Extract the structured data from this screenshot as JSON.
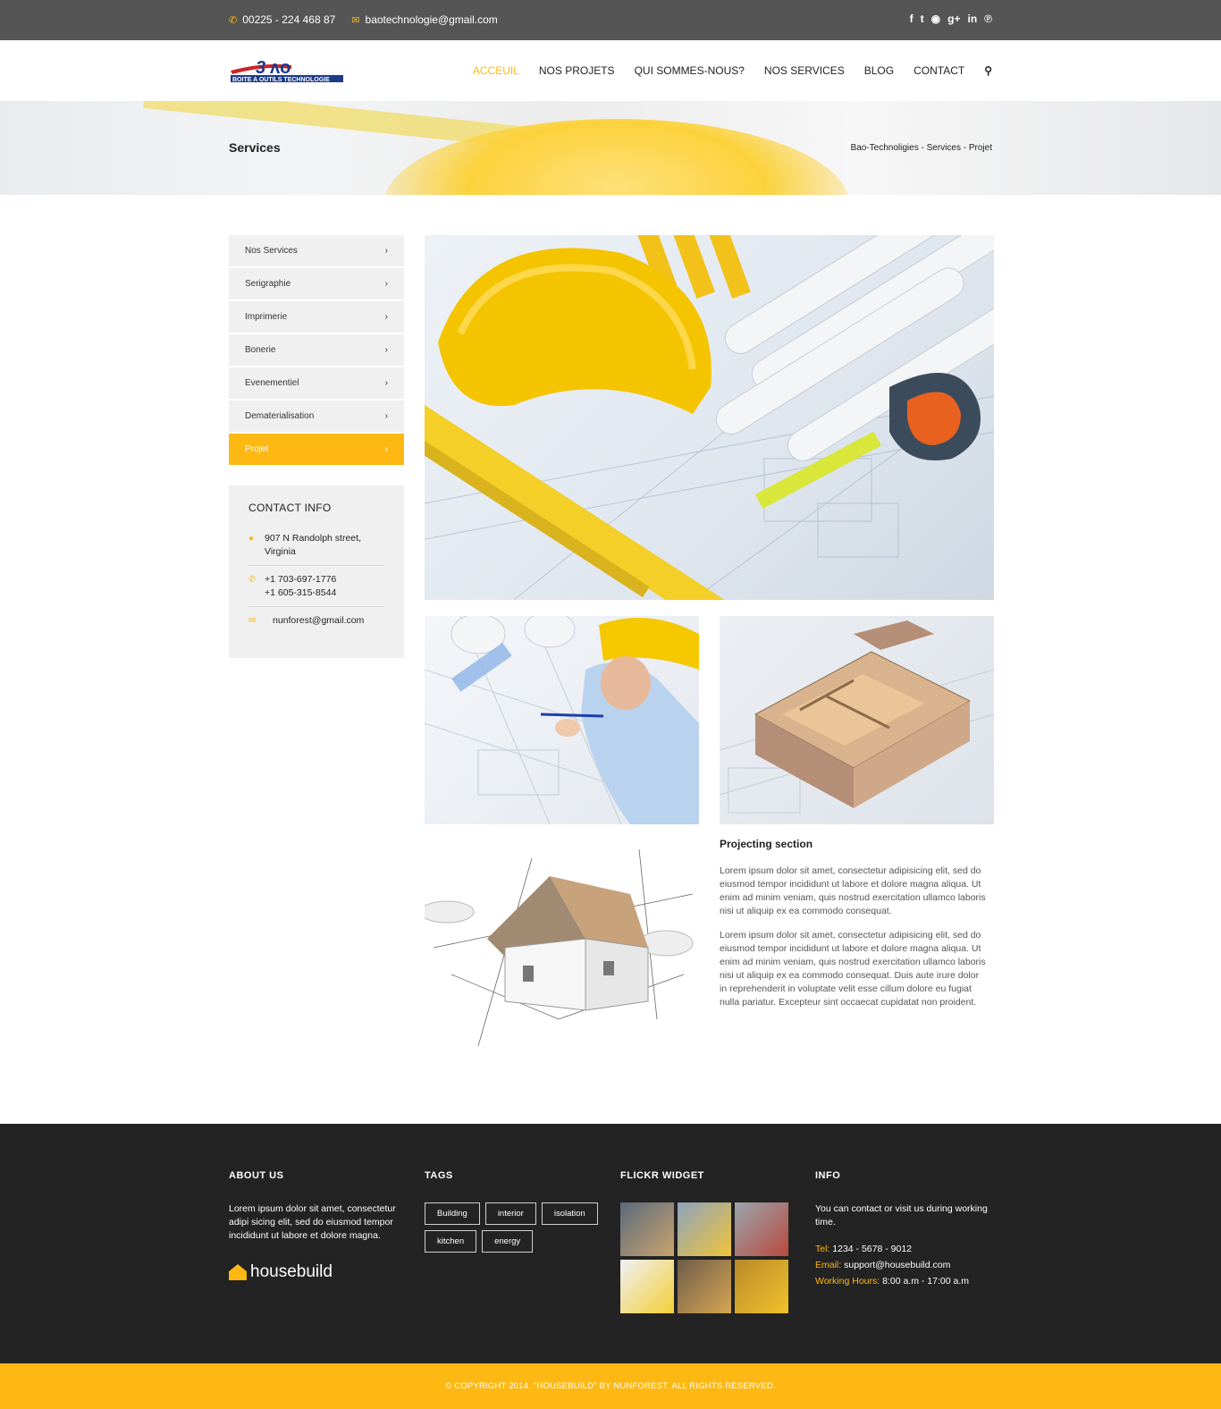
{
  "topbar": {
    "phone": "00225 - 224 468 87",
    "email": "baotechnologie@gmail.com",
    "social": [
      "f",
      "t",
      "rss",
      "g+",
      "in",
      "p"
    ]
  },
  "header": {
    "logo_top": "BAO",
    "logo_sub": "BOITE A OUTILS TECHNOLOGIE",
    "nav": [
      "ACCEUIL",
      "NOS PROJETS",
      "QUI SOMMES-NOUS?",
      "NOS SERVICES",
      "BLOG",
      "CONTACT"
    ],
    "active": "ACCEUIL"
  },
  "banner": {
    "title": "Services",
    "breadcrumb": [
      "Bao-Technoligies",
      "Services",
      "Projet"
    ]
  },
  "sidebar": {
    "items": [
      {
        "label": "Nos Services"
      },
      {
        "label": "Serigraphie"
      },
      {
        "label": "Imprimerie"
      },
      {
        "label": "Bonerie"
      },
      {
        "label": "Evenementiel"
      },
      {
        "label": "Dematerialisation"
      },
      {
        "label": "Projet"
      }
    ],
    "active": "Projet"
  },
  "contact_info": {
    "title": "CONTACT INFO",
    "address": "907 N Randolph street, Virginia",
    "phone1": "+1 703-697-1776",
    "phone2": "+1 605-315-8544",
    "email": "nunforest@gmail.com"
  },
  "section": {
    "title": "Projecting section",
    "p1": "Lorem ipsum dolor sit amet, consectetur adipisicing elit, sed do eiusmod tempor incididunt ut labore et dolore magna aliqua. Ut enim ad minim veniam, quis nostrud exercitation ullamco laboris nisi ut aliquip ex ea commodo consequat.",
    "p2": "Lorem ipsum dolor sit amet, consectetur adipisicing elit, sed do eiusmod tempor incididunt ut labore et dolore magna aliqua. Ut enim ad minim veniam, quis nostrud exercitation ullamco laboris nisi ut aliquip ex ea commodo consequat. Duis aute irure dolor in reprehenderit in voluptate velit esse cillum dolore eu fugiat nulla pariatur. Excepteur sint occaecat cupidatat non proident."
  },
  "footer": {
    "about_title": "ABOUT US",
    "about_text": "Lorem ipsum dolor sit amet, consectetur adipi sicing elit, sed do eiusmod tempor incididunt ut labore et dolore magna.",
    "brand": "housebuild",
    "tags_title": "TAGS",
    "tags": [
      "Building",
      "interior",
      "isolation",
      "kitchen",
      "energy"
    ],
    "flickr_title": "FLICKR WIDGET",
    "info_title": "INFO",
    "info_text": "You can contact or visit us during working time.",
    "tel_label": "Tel:",
    "tel": "1234 - 5678 - 9012",
    "email_label": "Email:",
    "email": "support@housebuild.com",
    "hours_label": "Working Hours:",
    "hours": "8:00 a.m - 17:00 a.m",
    "copyright": "© COPYRIGHT 2014. \"HOUSEBUILD\" BY NUNFOREST. ALL RIGHTS RESERVED."
  },
  "colors": {
    "accent": "#fdb813",
    "topbar": "#555555",
    "footer": "#232323"
  }
}
